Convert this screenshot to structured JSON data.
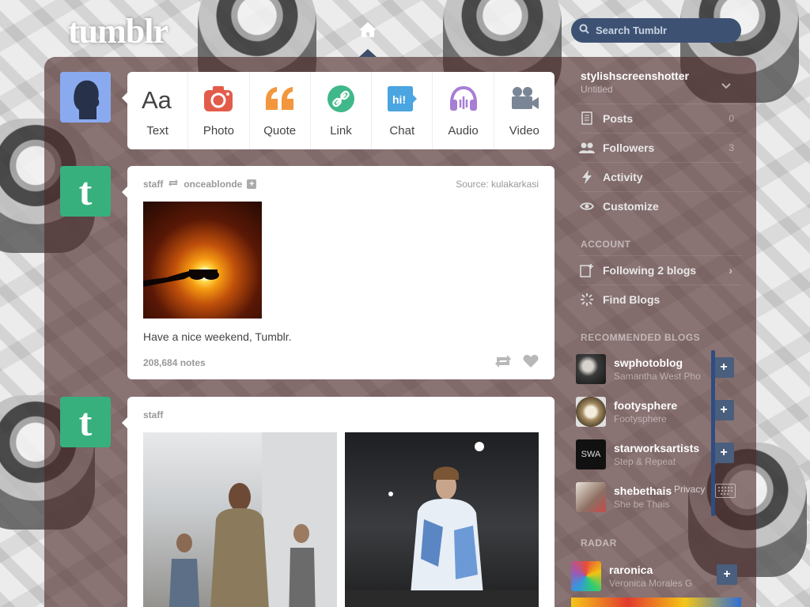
{
  "header": {
    "logo_text": "tumblr",
    "search_placeholder": "Search Tumblr"
  },
  "composer": {
    "types": [
      {
        "label": "Text",
        "icon": "text-icon",
        "color": "#444444"
      },
      {
        "label": "Photo",
        "icon": "camera-icon",
        "color": "#e35c4a"
      },
      {
        "label": "Quote",
        "icon": "quote-icon",
        "color": "#f2973e"
      },
      {
        "label": "Link",
        "icon": "link-icon",
        "color": "#41b88a"
      },
      {
        "label": "Chat",
        "icon": "chat-icon",
        "color": "#4aa5e0"
      },
      {
        "label": "Audio",
        "icon": "headphones-icon",
        "color": "#a77dd6"
      },
      {
        "label": "Video",
        "icon": "video-camera-icon",
        "color": "#7a8695"
      }
    ]
  },
  "posts": [
    {
      "author": "staff",
      "reblogged_from": "onceablonde",
      "source": "Source: kulakarkasi",
      "caption": "Have a nice weekend, Tumblr.",
      "notes": "208,684 notes"
    },
    {
      "author": "staff"
    }
  ],
  "sidebar": {
    "blog_name": "stylishscreenshotter",
    "blog_title": "Untitled",
    "items": [
      {
        "label": "Posts",
        "count": "0",
        "icon": "document-icon"
      },
      {
        "label": "Followers",
        "count": "3",
        "icon": "people-icon"
      },
      {
        "label": "Activity",
        "icon": "lightning-icon"
      },
      {
        "label": "Customize",
        "icon": "eye-icon"
      }
    ],
    "account_heading": "ACCOUNT",
    "account_items": [
      {
        "label": "Following 2 blogs",
        "icon": "add-person-icon"
      },
      {
        "label": "Find Blogs",
        "icon": "sparkle-icon"
      }
    ],
    "recommended_heading": "RECOMMENDED BLOGS",
    "recommended": [
      {
        "name": "swphotoblog",
        "subtitle": "Samantha West Pho",
        "color": "#2b2b2b"
      },
      {
        "name": "footysphere",
        "subtitle": "Footysphere",
        "color": "#8d7a5a"
      },
      {
        "name": "starworksartists",
        "subtitle": "Step & Repeat",
        "color": "#111111",
        "badge": "SWA"
      },
      {
        "name": "shebethais",
        "subtitle": "She be Thais",
        "color": "#b9a9a0"
      }
    ],
    "privacy_label": "Privacy",
    "radar_heading": "RADAR",
    "radar": {
      "name": "raronica",
      "subtitle": "Veronica Morales G"
    }
  }
}
